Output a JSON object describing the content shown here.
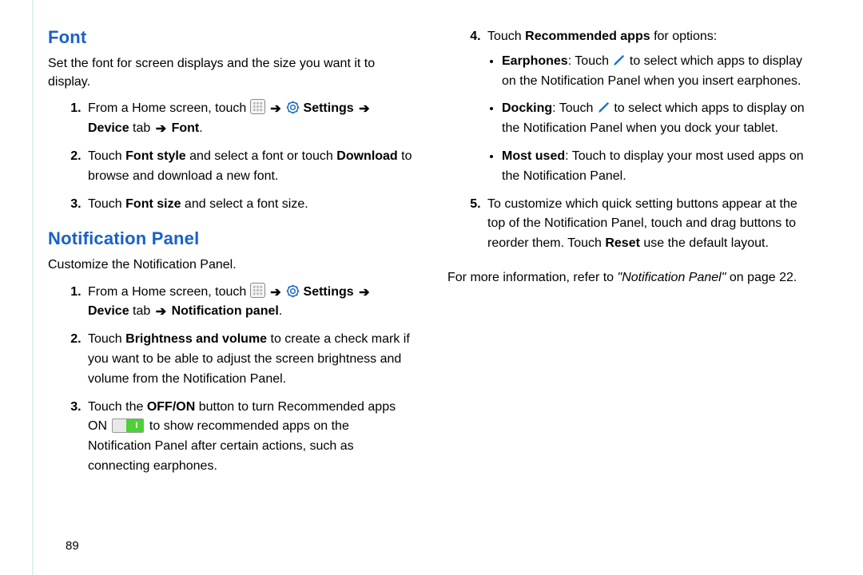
{
  "page_number": "89",
  "arrow": "➔",
  "left": {
    "font": {
      "heading": "Font",
      "lead": "Set the font for screen displays and the size you want it to display.",
      "step1_pre": "From a Home screen, touch ",
      "step1_settings": "Settings",
      "step1_device_tab": "Device",
      "step1_tab_word": " tab ",
      "step1_font": "Font",
      "step2_a": "Touch ",
      "step2_b": "Font style",
      "step2_c": " and select a font or touch ",
      "step2_d": "Download",
      "step2_e": " to browse and download a new font.",
      "step3_a": "Touch ",
      "step3_b": "Font size",
      "step3_c": " and select a font size."
    },
    "np": {
      "heading": "Notification Panel",
      "lead": "Customize the Notification Panel.",
      "step1_pre": "From a Home screen, touch ",
      "step1_settings": "Settings",
      "step1_device_tab": "Device",
      "step1_tab_word": " tab ",
      "step1_target": "Notification panel",
      "step2_a": "Touch ",
      "step2_b": "Brightness and volume",
      "step2_c": " to create a check mark if you want to be able to adjust the screen brightness and volume from the Notification Panel.",
      "step3_a": "Touch the ",
      "step3_b": "OFF/ON",
      "step3_c": " button to turn Recommended apps ON ",
      "step3_d": " to show recommended apps on the Notification Panel after certain actions, such as connecting earphones."
    }
  },
  "right": {
    "step4_a": "Touch ",
    "step4_b": "Recommended apps",
    "step4_c": " for options:",
    "earphones_label": "Earphones",
    "earphones_a": ": Touch ",
    "earphones_b": " to select which apps to display on the Notification Panel when you insert earphones.",
    "docking_label": "Docking",
    "docking_a": ": Touch ",
    "docking_b": " to select which apps to display on the Notification Panel when you dock your tablet.",
    "mostused_label": "Most used",
    "mostused_a": ": Touch to display your most used apps on the Notification Panel.",
    "step5_a": "To customize which quick setting buttons appear at the top of the Notification Panel, touch and drag buttons to reorder them. Touch ",
    "step5_b": "Reset",
    "step5_c": " use the default layout.",
    "ref_a": "For more information, refer to ",
    "ref_b": "\"Notification Panel\"",
    "ref_c": " on page 22."
  }
}
